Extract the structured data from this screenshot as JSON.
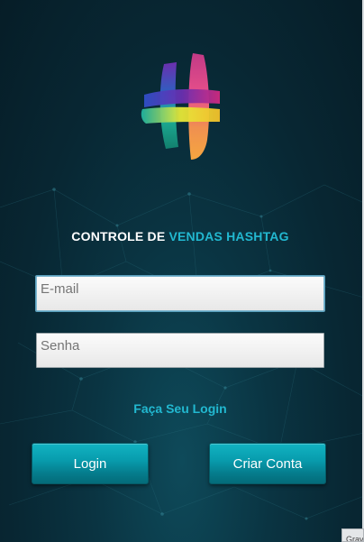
{
  "app": {
    "title_white": "CONTROLE DE ",
    "title_cyan": "VENDAS HASHTAG",
    "accent_color": "#22b8d0",
    "background_color": "#082733"
  },
  "logo": {
    "icon": "hashtag-logo-icon"
  },
  "form": {
    "email_placeholder": "E-mail",
    "email_value": "",
    "password_placeholder": "Senha",
    "password_value": "",
    "login_link": "Faça Seu Login"
  },
  "buttons": {
    "login_label": "Login",
    "create_account_label": "Criar Conta",
    "button_color": "#089dae"
  },
  "corner_badge": {
    "label": "Grav"
  }
}
